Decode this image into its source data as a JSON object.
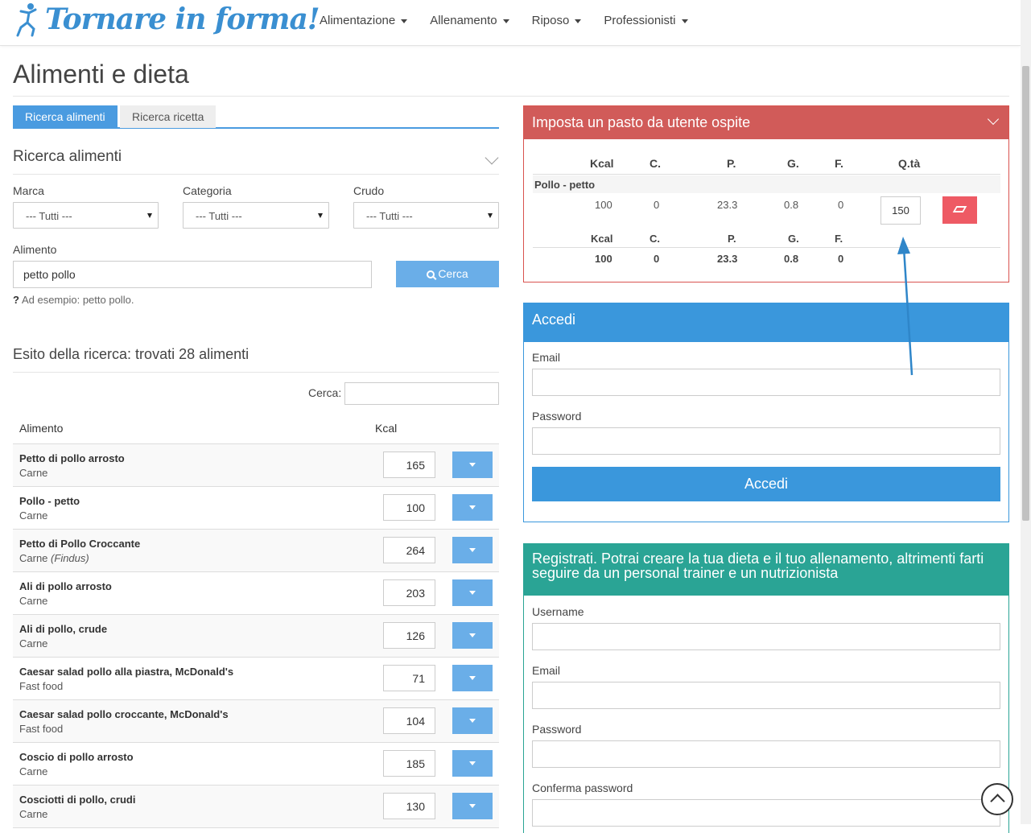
{
  "brand": {
    "name": "Tornare in forma!",
    "color": "#3a8fd1"
  },
  "nav": {
    "items": [
      {
        "label": "Alimentazione"
      },
      {
        "label": "Allenamento"
      },
      {
        "label": "Riposo"
      },
      {
        "label": "Professionisti"
      }
    ]
  },
  "page": {
    "title": "Alimenti e dieta"
  },
  "tabs": [
    {
      "label": "Ricerca alimenti",
      "active": true
    },
    {
      "label": "Ricerca ricetta",
      "active": false
    }
  ],
  "search": {
    "section_title": "Ricerca alimenti",
    "marca_label": "Marca",
    "marca_value": "--- Tutti ---",
    "categoria_label": "Categoria",
    "categoria_value": "--- Tutti ---",
    "crudo_label": "Crudo",
    "crudo_value": "--- Tutti ---",
    "alimento_label": "Alimento",
    "alimento_value": "petto pollo",
    "button_label": "Cerca",
    "hint_mark": "?",
    "hint": "Ad esempio: petto pollo."
  },
  "results": {
    "title": "Esito della ricerca: trovati 28 alimenti",
    "filter_label": "Cerca:",
    "col_alimento": "Alimento",
    "col_kcal": "Kcal",
    "rows": [
      {
        "name": "Petto di pollo arrosto",
        "category": "Carne",
        "brand": "",
        "kcal": "165"
      },
      {
        "name": "Pollo - petto",
        "category": "Carne",
        "brand": "",
        "kcal": "100"
      },
      {
        "name": "Petto di Pollo Croccante",
        "category": "Carne",
        "brand": "(Findus)",
        "kcal": "264"
      },
      {
        "name": "Ali di pollo arrosto",
        "category": "Carne",
        "brand": "",
        "kcal": "203"
      },
      {
        "name": "Ali di pollo, crude",
        "category": "Carne",
        "brand": "",
        "kcal": "126"
      },
      {
        "name": "Caesar salad pollo alla piastra, McDonald's",
        "category": "Fast food",
        "brand": "",
        "kcal": "71"
      },
      {
        "name": "Caesar salad pollo croccante, McDonald's",
        "category": "Fast food",
        "brand": "",
        "kcal": "104"
      },
      {
        "name": "Coscio di pollo arrosto",
        "category": "Carne",
        "brand": "",
        "kcal": "185"
      },
      {
        "name": "Cosciotti di pollo, crudi",
        "category": "Carne",
        "brand": "",
        "kcal": "130"
      }
    ]
  },
  "meal": {
    "title": "Imposta un pasto da utente ospite",
    "color": "#d15b59",
    "headers": {
      "kcal": "Kcal",
      "c": "C.",
      "p": "P.",
      "g": "G.",
      "f": "F.",
      "qty": "Q.tà"
    },
    "food_name": "Pollo - petto",
    "item": {
      "kcal": "100",
      "c": "0",
      "p": "23.3",
      "g": "0.8",
      "f": "0",
      "qty": "150"
    },
    "totals": {
      "kcal": "100",
      "c": "0",
      "p": "23.3",
      "g": "0.8",
      "f": "0"
    }
  },
  "login": {
    "title": "Accedi",
    "color": "#3a97dc",
    "email_label": "Email",
    "password_label": "Password",
    "button_label": "Accedi"
  },
  "register": {
    "title": "Registrati. Potrai creare la tua dieta e il tuo allenamento, altrimenti farti seguire da un personal trainer e un nutrizionista",
    "color": "#2aa495",
    "username_label": "Username",
    "email_label": "Email",
    "password_label": "Password",
    "confirm_label": "Conferma password"
  }
}
